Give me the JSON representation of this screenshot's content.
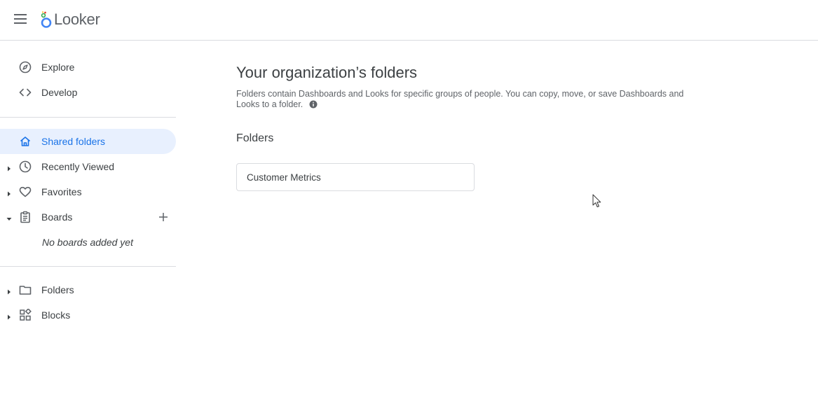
{
  "app": {
    "logo_text": "Looker",
    "menu_icon": "hamburger-menu-icon"
  },
  "sidebar": {
    "items": [
      {
        "label": "Explore",
        "icon": "compass-icon"
      },
      {
        "label": "Develop",
        "icon": "code-icon"
      },
      {
        "label": "Shared folders",
        "icon": "home-icon",
        "active": true
      },
      {
        "label": "Recently Viewed",
        "icon": "clock-icon"
      },
      {
        "label": "Favorites",
        "icon": "heart-icon"
      },
      {
        "label": "Boards",
        "icon": "clipboard-icon"
      },
      {
        "label": "Folders",
        "icon": "folder-icon"
      },
      {
        "label": "Blocks",
        "icon": "blocks-icon"
      }
    ],
    "boards_empty_text": "No boards added yet"
  },
  "main": {
    "title": "Your organization’s folders",
    "description": "Folders contain Dashboards and Looks for specific groups of people. You can copy, move, or save Dashboards and Looks to a folder.",
    "section_title": "Folders",
    "folders": [
      {
        "name": "Customer Metrics"
      }
    ]
  },
  "colors": {
    "accent": "#1a73e8",
    "active_bg": "#e8f0fe",
    "text": "#3c4043",
    "muted": "#5f6368",
    "border": "#dadce0"
  }
}
